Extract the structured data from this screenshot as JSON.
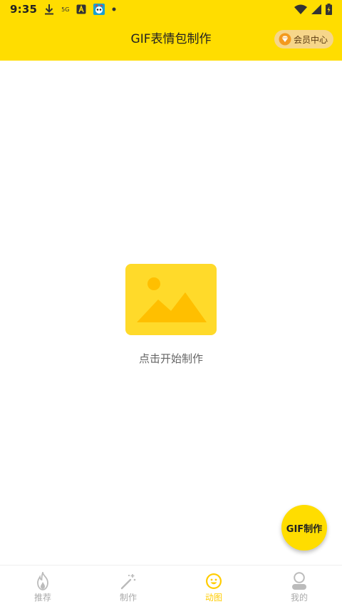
{
  "status_bar": {
    "time": "9:35",
    "network_label": "5G",
    "icons": [
      "download-icon",
      "5g-icon",
      "a-app-icon",
      "app-notification-icon",
      "dot-icon",
      "wifi-icon",
      "signal-icon",
      "battery-icon"
    ]
  },
  "header": {
    "title": "GIF表情包制作",
    "vip_label": "会员中心",
    "background": "#FFDD00"
  },
  "main": {
    "start_label": "点击开始制作",
    "placeholder_icon": "image-icon"
  },
  "fab": {
    "label": "GIF制作"
  },
  "nav": {
    "items": [
      {
        "label": "推荐",
        "icon": "flame-icon",
        "active": false
      },
      {
        "label": "制作",
        "icon": "magic-wand-icon",
        "active": false
      },
      {
        "label": "动图",
        "icon": "smiley-icon",
        "active": true
      },
      {
        "label": "我的",
        "icon": "user-icon",
        "active": false
      }
    ],
    "active_color": "#FFCC00",
    "inactive_color": "#AAAAAA"
  }
}
